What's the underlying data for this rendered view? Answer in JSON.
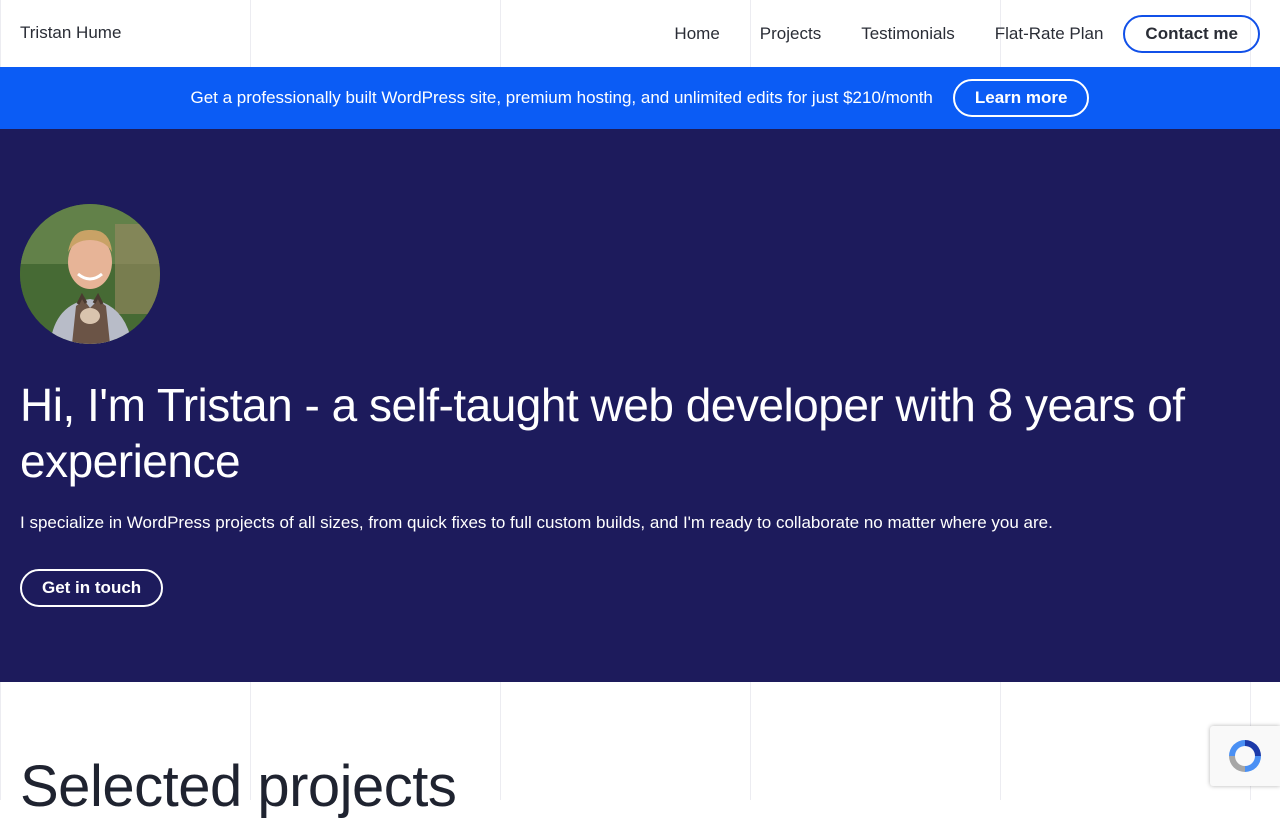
{
  "header": {
    "brand": "Tristan Hume",
    "nav": [
      {
        "label": "Home"
      },
      {
        "label": "Projects"
      },
      {
        "label": "Testimonials"
      },
      {
        "label": "Flat-Rate Plan"
      }
    ],
    "contact_label": "Contact me"
  },
  "promo": {
    "text": "Get a professionally built WordPress site, premium hosting, and unlimited edits for just $210/month",
    "button_label": "Learn more"
  },
  "hero": {
    "title": "Hi, I'm Tristan - a self-taught web developer with 8 years of experience",
    "subtitle": "I specialize in WordPress projects of all sizes, from quick fixes to full custom builds, and I'm ready to collaborate no matter where you are.",
    "button_label": "Get in touch"
  },
  "projects": {
    "title": "Selected projects"
  },
  "colors": {
    "accent": "#0b5cf5",
    "hero_bg": "#1d1b5c",
    "outline_blue": "#1150e8"
  },
  "icons": {
    "recaptcha": "recaptcha-icon"
  }
}
